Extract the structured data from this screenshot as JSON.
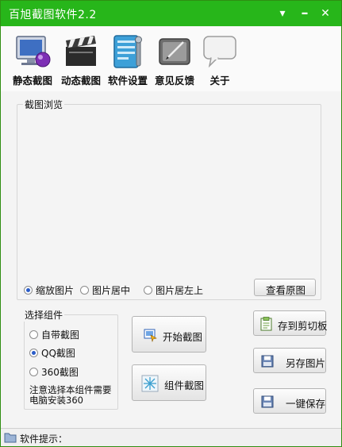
{
  "window": {
    "title": "百旭截图软件2.2",
    "menu_glyph": "▾",
    "close_glyph": "✕"
  },
  "toolbar": {
    "items": [
      {
        "label": "静态截图",
        "icon": "monitor-icon"
      },
      {
        "label": "动态截图",
        "icon": "clapperboard-icon"
      },
      {
        "label": "软件设置",
        "icon": "settings-icon"
      },
      {
        "label": "意见反馈",
        "icon": "feedback-icon"
      },
      {
        "label": "关于",
        "icon": "speech-bubble-icon"
      }
    ]
  },
  "preview": {
    "legend": "截图浏览",
    "options": [
      {
        "label": "缩放图片",
        "selected": true
      },
      {
        "label": "图片居中",
        "selected": false
      },
      {
        "label": "图片居左上",
        "selected": false
      }
    ],
    "view_original_label": "查看原图"
  },
  "components": {
    "legend": "选择组件",
    "options": [
      {
        "label": "自带截图",
        "selected": false
      },
      {
        "label": "QQ截图",
        "selected": true
      },
      {
        "label": "360截图",
        "selected": false
      }
    ],
    "note": "注意选择本组件需要电脑安装360"
  },
  "actions": {
    "start_capture": "开始截图",
    "component_capture": "组件截图",
    "save_clipboard": "存到剪切板",
    "save_as": "另存图片",
    "one_click_save": "一键保存"
  },
  "status": {
    "label": "软件提示："
  }
}
